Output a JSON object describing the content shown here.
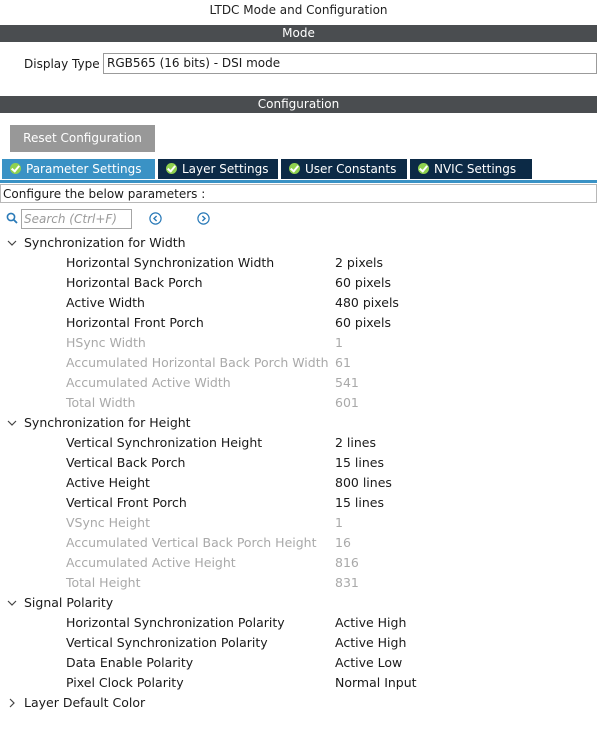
{
  "window": {
    "title": "LTDC Mode and Configuration"
  },
  "mode": {
    "header": "Mode",
    "display_type_label": "Display Type",
    "display_type_value": "RGB565 (16 bits) - DSI mode"
  },
  "configuration": {
    "header": "Configuration",
    "reset_label": "Reset Configuration",
    "tabs": [
      {
        "label": "Parameter Settings",
        "active": true
      },
      {
        "label": "Layer Settings",
        "active": false
      },
      {
        "label": "User Constants",
        "active": false
      },
      {
        "label": "NVIC Settings",
        "active": false
      }
    ],
    "instruction": "Configure the below parameters :",
    "search_placeholder": "Search (Ctrl+F)"
  },
  "groups": [
    {
      "label": "Synchronization for Width",
      "expanded": true,
      "params": [
        {
          "name": "Horizontal Synchronization Width",
          "value": "2 pixels",
          "readonly": false
        },
        {
          "name": "Horizontal Back Porch",
          "value": "60 pixels",
          "readonly": false
        },
        {
          "name": "Active Width",
          "value": "480 pixels",
          "readonly": false
        },
        {
          "name": "Horizontal Front Porch",
          "value": "60 pixels",
          "readonly": false
        },
        {
          "name": "HSync Width",
          "value": "1",
          "readonly": true
        },
        {
          "name": "Accumulated Horizontal Back Porch Width",
          "value": "61",
          "readonly": true
        },
        {
          "name": "Accumulated Active Width",
          "value": "541",
          "readonly": true
        },
        {
          "name": "Total Width",
          "value": "601",
          "readonly": true
        }
      ]
    },
    {
      "label": "Synchronization for Height",
      "expanded": true,
      "params": [
        {
          "name": "Vertical Synchronization Height",
          "value": "2 lines",
          "readonly": false
        },
        {
          "name": "Vertical Back Porch",
          "value": "15 lines",
          "readonly": false
        },
        {
          "name": "Active Height",
          "value": "800 lines",
          "readonly": false
        },
        {
          "name": "Vertical Front Porch",
          "value": "15 lines",
          "readonly": false
        },
        {
          "name": "VSync Height",
          "value": "1",
          "readonly": true
        },
        {
          "name": "Accumulated Vertical Back Porch Height",
          "value": "16",
          "readonly": true
        },
        {
          "name": "Accumulated Active Height",
          "value": "816",
          "readonly": true
        },
        {
          "name": "Total Height",
          "value": "831",
          "readonly": true
        }
      ]
    },
    {
      "label": "Signal Polarity",
      "expanded": true,
      "params": [
        {
          "name": "Horizontal Synchronization Polarity",
          "value": "Active High",
          "readonly": false
        },
        {
          "name": "Vertical Synchronization Polarity",
          "value": "Active High",
          "readonly": false
        },
        {
          "name": "Data Enable Polarity",
          "value": "Active Low",
          "readonly": false
        },
        {
          "name": "Pixel Clock Polarity",
          "value": "Normal Input",
          "readonly": false
        }
      ]
    },
    {
      "label": "Layer Default Color",
      "expanded": false,
      "params": []
    }
  ],
  "colors": {
    "header_bar": "#4a4d50",
    "tab_active": "#3a92c5",
    "tab_inactive": "#0c2a46",
    "check_icon": "#8fd14f",
    "readonly_text": "#a9a9a9",
    "reset_button": "#989898"
  },
  "icons": {
    "tab_icon": "check-circle-icon",
    "search": "search-icon",
    "prev": "previous-match-icon",
    "next": "next-match-icon",
    "expanded": "chevron-down-icon",
    "collapsed": "chevron-right-icon"
  }
}
